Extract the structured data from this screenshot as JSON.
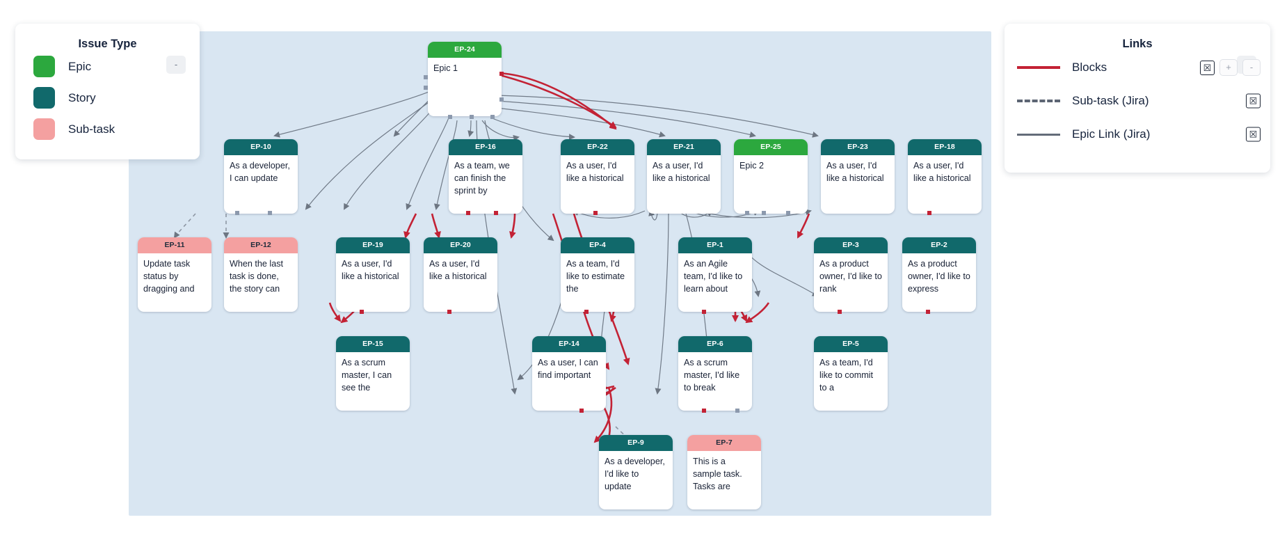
{
  "issue_type_panel": {
    "title": "Issue Type",
    "collapse_label": "-",
    "items": [
      {
        "label": "Epic",
        "color": "#2ca83e"
      },
      {
        "label": "Story",
        "color": "#11696b"
      },
      {
        "label": "Sub-task",
        "color": "#f4a0a0"
      }
    ]
  },
  "links_panel": {
    "title": "Links",
    "collapse_label": "-",
    "rows": [
      {
        "label": "Blocks",
        "style": "solid-red",
        "color": "#c32235",
        "close_label": "☒",
        "plus_label": "+",
        "minus_label": "-"
      },
      {
        "label": "Sub-task (Jira)",
        "style": "dashed",
        "color": "#5c6573",
        "close_label": "☒"
      },
      {
        "label": "Epic Link (Jira)",
        "style": "solid-gray",
        "color": "#636c79",
        "close_label": "☒"
      }
    ]
  },
  "graph": {
    "nodes": [
      {
        "id": "EP-24",
        "type": "epic",
        "summary": "Epic 1"
      },
      {
        "id": "EP-10",
        "type": "story",
        "summary": "As a developer, I can update"
      },
      {
        "id": "EP-16",
        "type": "story",
        "summary": "As a team, we can finish the sprint by"
      },
      {
        "id": "EP-22",
        "type": "story",
        "summary": "As a user, I'd like a historical"
      },
      {
        "id": "EP-21",
        "type": "story",
        "summary": "As a user, I'd like a historical"
      },
      {
        "id": "EP-25",
        "type": "epic",
        "summary": "Epic 2"
      },
      {
        "id": "EP-23",
        "type": "story",
        "summary": "As a user, I'd like a historical"
      },
      {
        "id": "EP-18",
        "type": "story",
        "summary": "As a user, I'd like a historical"
      },
      {
        "id": "EP-11",
        "type": "subtask",
        "summary": "Update task status by dragging and"
      },
      {
        "id": "EP-12",
        "type": "subtask",
        "summary": "When the last task is done, the story can"
      },
      {
        "id": "EP-19",
        "type": "story",
        "summary": "As a user, I'd like a historical"
      },
      {
        "id": "EP-20",
        "type": "story",
        "summary": "As a user, I'd like a historical"
      },
      {
        "id": "EP-4",
        "type": "story",
        "summary": "As a team, I'd like to estimate the"
      },
      {
        "id": "EP-1",
        "type": "story",
        "summary": "As an Agile team, I'd like to learn about"
      },
      {
        "id": "EP-3",
        "type": "story",
        "summary": "As a product owner, I'd like to rank"
      },
      {
        "id": "EP-2",
        "type": "story",
        "summary": "As a product owner, I'd like to express"
      },
      {
        "id": "EP-15",
        "type": "story",
        "summary": "As a scrum master, I can see the"
      },
      {
        "id": "EP-14",
        "type": "story",
        "summary": "As a user, I can find important"
      },
      {
        "id": "EP-6",
        "type": "story",
        "summary": "As a scrum master, I'd like to break"
      },
      {
        "id": "EP-5",
        "type": "story",
        "summary": "As a team, I'd like to commit to a"
      },
      {
        "id": "EP-9",
        "type": "story",
        "summary": "As a developer, I'd like to update"
      },
      {
        "id": "EP-7",
        "type": "subtask",
        "summary": "This is a sample task. Tasks are"
      }
    ]
  }
}
